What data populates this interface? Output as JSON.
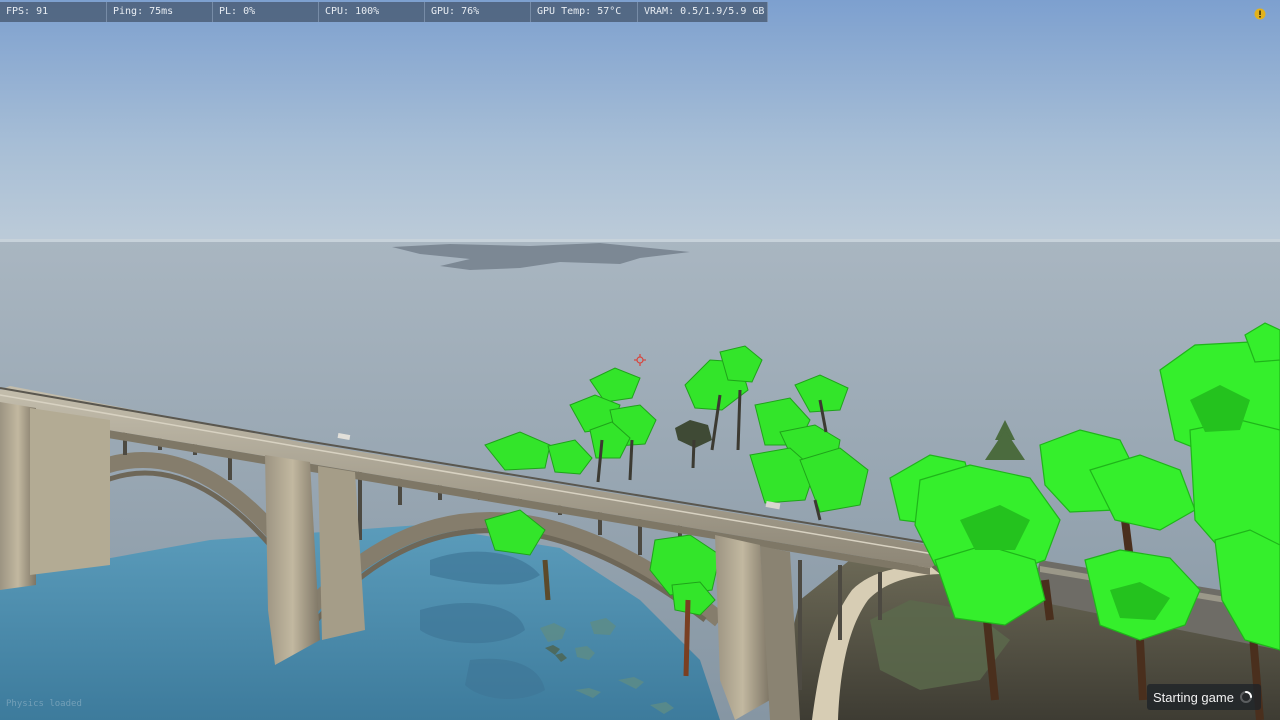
{
  "hud": {
    "stats": {
      "fps": "FPS: 91",
      "ping": "Ping: 75ms",
      "packet_loss": "PL: 0%",
      "cpu": "CPU: 100%",
      "gpu": "GPU: 76%",
      "gpu_temp": "GPU Temp: 57°C",
      "vram": "VRAM: 0.5/1.9/5.9 GB"
    },
    "status_icon": "warning-icon",
    "crosshair_icon": "crosshair-icon"
  },
  "loading": {
    "label": "Starting game",
    "spinner_icon": "spinner-icon"
  },
  "watermark": {
    "text": "Physics loaded"
  },
  "colors": {
    "sky_top": "#7da0cf",
    "sky_horizon": "#b9cad8",
    "sea": "#9aaab5",
    "river": "#4e8fb0",
    "foliage": "#35ef2c",
    "bridge": "#aea693",
    "hud_panel": "#465870"
  }
}
